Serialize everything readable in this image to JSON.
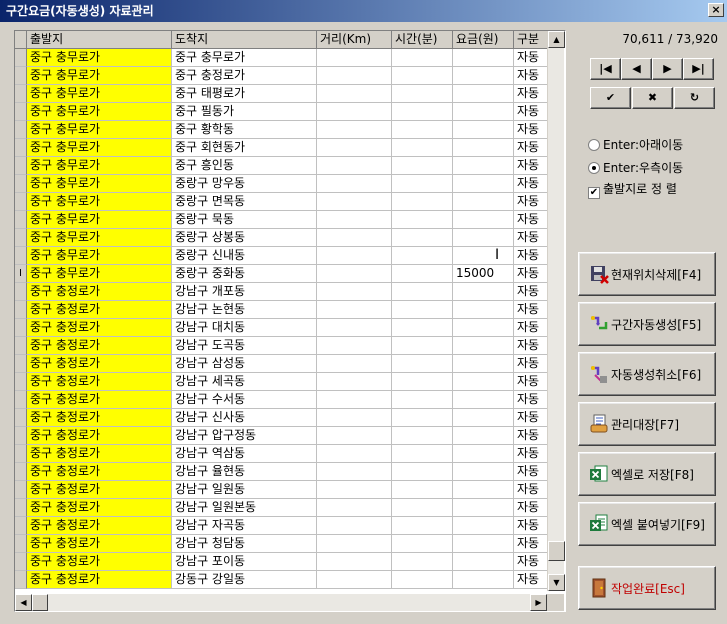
{
  "window": {
    "title": "구간요금(자동생성) 자료관리",
    "close_label": "×"
  },
  "grid": {
    "headers": [
      "출발지",
      "도착지",
      "거리(Km)",
      "시간(분)",
      "요금(원)",
      "구분"
    ],
    "rows": [
      {
        "indicator": "",
        "dep": "중구 충무로가",
        "arr": "중구 충무로가",
        "dist": "",
        "time": "",
        "fee": "",
        "kind": "자동"
      },
      {
        "indicator": "",
        "dep": "중구 충무로가",
        "arr": "중구 충정로가",
        "dist": "",
        "time": "",
        "fee": "",
        "kind": "자동"
      },
      {
        "indicator": "",
        "dep": "중구 충무로가",
        "arr": "중구 태평로가",
        "dist": "",
        "time": "",
        "fee": "",
        "kind": "자동"
      },
      {
        "indicator": "",
        "dep": "중구 충무로가",
        "arr": "중구 필동가",
        "dist": "",
        "time": "",
        "fee": "",
        "kind": "자동"
      },
      {
        "indicator": "",
        "dep": "중구 충무로가",
        "arr": "중구 황학동",
        "dist": "",
        "time": "",
        "fee": "",
        "kind": "자동"
      },
      {
        "indicator": "",
        "dep": "중구 충무로가",
        "arr": "중구 회현동가",
        "dist": "",
        "time": "",
        "fee": "",
        "kind": "자동"
      },
      {
        "indicator": "",
        "dep": "중구 충무로가",
        "arr": "중구 흥인동",
        "dist": "",
        "time": "",
        "fee": "",
        "kind": "자동"
      },
      {
        "indicator": "",
        "dep": "중구 충무로가",
        "arr": "중랑구 망우동",
        "dist": "",
        "time": "",
        "fee": "",
        "kind": "자동"
      },
      {
        "indicator": "",
        "dep": "중구 충무로가",
        "arr": "중랑구 면목동",
        "dist": "",
        "time": "",
        "fee": "",
        "kind": "자동"
      },
      {
        "indicator": "",
        "dep": "중구 충무로가",
        "arr": "중랑구 묵동",
        "dist": "",
        "time": "",
        "fee": "",
        "kind": "자동"
      },
      {
        "indicator": "",
        "dep": "중구 충무로가",
        "arr": "중랑구 상봉동",
        "dist": "",
        "time": "",
        "fee": "",
        "kind": "자동"
      },
      {
        "indicator": "",
        "dep": "중구 충무로가",
        "arr": "중랑구 신내동",
        "dist": "",
        "time": "",
        "fee": "",
        "kind": "자동"
      },
      {
        "indicator": "I",
        "dep": "중구 충무로가",
        "arr": "중랑구 중화동",
        "dist": "",
        "time": "",
        "fee": "15000",
        "kind": "자동"
      },
      {
        "indicator": "",
        "dep": "중구 충정로가",
        "arr": "강남구 개포동",
        "dist": "",
        "time": "",
        "fee": "",
        "kind": "자동"
      },
      {
        "indicator": "",
        "dep": "중구 충정로가",
        "arr": "강남구 논현동",
        "dist": "",
        "time": "",
        "fee": "",
        "kind": "자동"
      },
      {
        "indicator": "",
        "dep": "중구 충정로가",
        "arr": "강남구 대치동",
        "dist": "",
        "time": "",
        "fee": "",
        "kind": "자동"
      },
      {
        "indicator": "",
        "dep": "중구 충정로가",
        "arr": "강남구 도곡동",
        "dist": "",
        "time": "",
        "fee": "",
        "kind": "자동"
      },
      {
        "indicator": "",
        "dep": "중구 충정로가",
        "arr": "강남구 삼성동",
        "dist": "",
        "time": "",
        "fee": "",
        "kind": "자동"
      },
      {
        "indicator": "",
        "dep": "중구 충정로가",
        "arr": "강남구 세곡동",
        "dist": "",
        "time": "",
        "fee": "",
        "kind": "자동"
      },
      {
        "indicator": "",
        "dep": "중구 충정로가",
        "arr": "강남구 수서동",
        "dist": "",
        "time": "",
        "fee": "",
        "kind": "자동"
      },
      {
        "indicator": "",
        "dep": "중구 충정로가",
        "arr": "강남구 신사동",
        "dist": "",
        "time": "",
        "fee": "",
        "kind": "자동"
      },
      {
        "indicator": "",
        "dep": "중구 충정로가",
        "arr": "강남구 압구정동",
        "dist": "",
        "time": "",
        "fee": "",
        "kind": "자동"
      },
      {
        "indicator": "",
        "dep": "중구 충정로가",
        "arr": "강남구 역삼동",
        "dist": "",
        "time": "",
        "fee": "",
        "kind": "자동"
      },
      {
        "indicator": "",
        "dep": "중구 충정로가",
        "arr": "강남구 율현동",
        "dist": "",
        "time": "",
        "fee": "",
        "kind": "자동"
      },
      {
        "indicator": "",
        "dep": "중구 충정로가",
        "arr": "강남구 일원동",
        "dist": "",
        "time": "",
        "fee": "",
        "kind": "자동"
      },
      {
        "indicator": "",
        "dep": "중구 충정로가",
        "arr": "강남구 일원본동",
        "dist": "",
        "time": "",
        "fee": "",
        "kind": "자동"
      },
      {
        "indicator": "",
        "dep": "중구 충정로가",
        "arr": "강남구 자곡동",
        "dist": "",
        "time": "",
        "fee": "",
        "kind": "자동"
      },
      {
        "indicator": "",
        "dep": "중구 충정로가",
        "arr": "강남구 청담동",
        "dist": "",
        "time": "",
        "fee": "",
        "kind": "자동"
      },
      {
        "indicator": "",
        "dep": "중구 충정로가",
        "arr": "강남구 포이동",
        "dist": "",
        "time": "",
        "fee": "",
        "kind": "자동"
      },
      {
        "indicator": "",
        "dep": "중구 충정로가",
        "arr": "강동구 강일동",
        "dist": "",
        "time": "",
        "fee": "",
        "kind": "자동"
      }
    ]
  },
  "record_count": "70,611 / 73,920",
  "nav": {
    "first": "|◀",
    "prev": "◀",
    "next": "▶",
    "last": "▶|",
    "confirm": "✔",
    "cancel": "✖",
    "refresh": "↻"
  },
  "options": {
    "enter_down": "Enter:아래이동",
    "enter_right": "Enter:우측이동",
    "sort_by_departure": "출발지로 정 렬",
    "check_mark": "✔"
  },
  "actions": {
    "delete_current": "현재위치삭제[F4]",
    "auto_generate": "구간자동생성[F5]",
    "cancel_generate": "자동생성취소[F6]",
    "ledger": "관리대장[F7]",
    "save_excel": "엑셀로 저장[F8]",
    "paste_excel": "엑셀 붙여넣기[F9]",
    "finish": "작업완료[Esc]"
  },
  "colors": {
    "departure_highlight": "#ffff00",
    "finish_text": "#c00000"
  }
}
